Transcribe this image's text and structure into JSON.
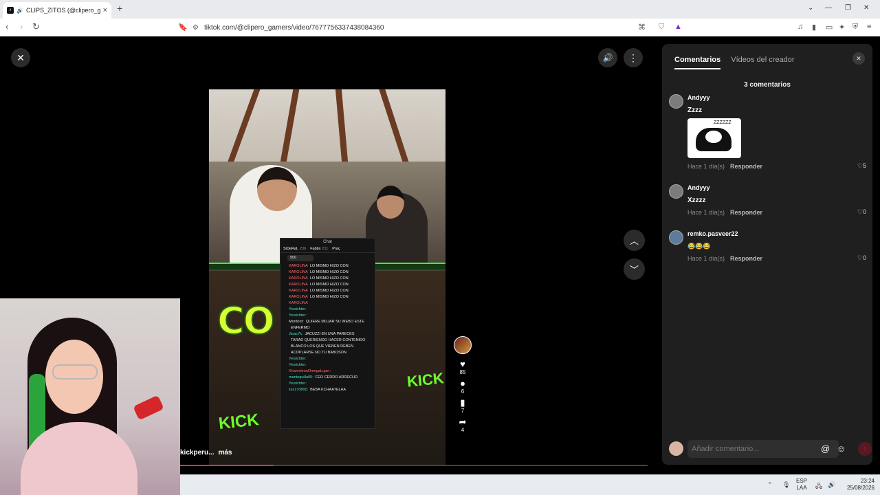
{
  "browser": {
    "tab_title": "CLIPS_ZITOS (@clipero_gamers)",
    "tab_audio_icon": "speaker-icon",
    "url": "tiktok.com/@clipero_gamers/video/7677756337438084360"
  },
  "player": {
    "close_icon": "close-icon",
    "volume_icon": "speaker-icon",
    "more_icon": "more-vertical-icon"
  },
  "chat_overlay": {
    "title": "Chat",
    "leaders": [
      {
        "name": "SiDeRaL",
        "score": "236"
      },
      {
        "name": "Fabbx",
        "score": "211"
      },
      {
        "name": "Praç",
        "score": ""
      }
    ],
    "pill": "500",
    "lines": [
      {
        "user": "KAROLINA",
        "text": "LO MISMO HIZO CON",
        "color": "red"
      },
      {
        "user": "KAROLINA",
        "text": "LO MISMO HIZO CON",
        "color": "red"
      },
      {
        "user": "KAROLINA",
        "text": "LO MISMO HIZO CON",
        "color": "red"
      },
      {
        "user": "KAROLINA",
        "text": "LO MISMO HIZO CON",
        "color": "red"
      },
      {
        "user": "KAROLINA",
        "text": "LO MISMO HIZO CON",
        "color": "red"
      },
      {
        "user": "KAROLINA",
        "text": "LO MISMO HIZO CON",
        "color": "red"
      },
      {
        "user": "KAROLINA",
        "text": "",
        "color": "red"
      },
      {
        "user": "Yesrichter:",
        "text": "",
        "color": "teal"
      },
      {
        "user": "Yesrichter:",
        "text": "",
        "color": "teal"
      },
      {
        "user": "Mordorit:",
        "text": "QUIERE MOJAR SU WEBO ESTE",
        "color": "white"
      },
      {
        "user": "",
        "text": "ENFERMO",
        "color": "white"
      },
      {
        "user": "Jtoac7k:",
        "text": "JACUZZI EN UNA PARECES",
        "color": "teal"
      },
      {
        "user": "",
        "text": "TARAD QUERIENDO HACER CONTENIDO",
        "color": "white"
      },
      {
        "user": "",
        "text": "BLANCO LOS QUE VIENEN DEBEN",
        "color": "white"
      },
      {
        "user": "",
        "text": "ACOPLARSE NO TU BABOSON",
        "color": "white"
      },
      {
        "user": "Yesrichter:",
        "text": "",
        "color": "teal"
      },
      {
        "user": "Yesrichter:",
        "text": "",
        "color": "teal"
      },
      {
        "user": "KhameleonOmegaLujan:",
        "text": "",
        "color": "red"
      },
      {
        "user": "mantequilla05:",
        "text": "FEO CERDO ARRECHO",
        "color": "teal"
      },
      {
        "user": "Yesrichter:",
        "text": "",
        "color": "teal"
      },
      {
        "user": "luis170800:",
        "text": "BEBA KCHAATELAA",
        "color": "teal"
      }
    ]
  },
  "video_text": {
    "cook_title": "CO  DO",
    "kick_left": "KICK",
    "kick_right": "KICK"
  },
  "caption": {
    "text": "kickperu...",
    "more": "más"
  },
  "actions": {
    "likes": "85",
    "comments": "6",
    "saves": "7",
    "shares": "4"
  },
  "panel": {
    "tabs": [
      {
        "label": "Comentarios",
        "active": true
      },
      {
        "label": "Vídeos del creador",
        "active": false
      }
    ],
    "count_label": "3 comentarios",
    "comments": [
      {
        "user": "Andyyy",
        "text": "Zzzz",
        "sticker_text": "ZZZZZZ",
        "time": "Hace 1 día(s)",
        "reply": "Responder",
        "likes": "5"
      },
      {
        "user": "Andyyy",
        "text": "Xzzzz",
        "time": "Hace 1 día(s)",
        "reply": "Responder",
        "likes": "0"
      },
      {
        "user": "remko.pasveer22",
        "text": "😂😂😂",
        "time": "Hace 1 día(s)",
        "reply": "Responder",
        "likes": "0"
      }
    ],
    "composer_placeholder": "Añadir comentario..."
  },
  "taskbar": {
    "lang_top": "ESP",
    "lang_bottom": "LAA",
    "time": "23:24",
    "date": "25/08/2026"
  },
  "colors": {
    "accent": "#fe2c55",
    "panel_bg": "#1f1f1f"
  }
}
